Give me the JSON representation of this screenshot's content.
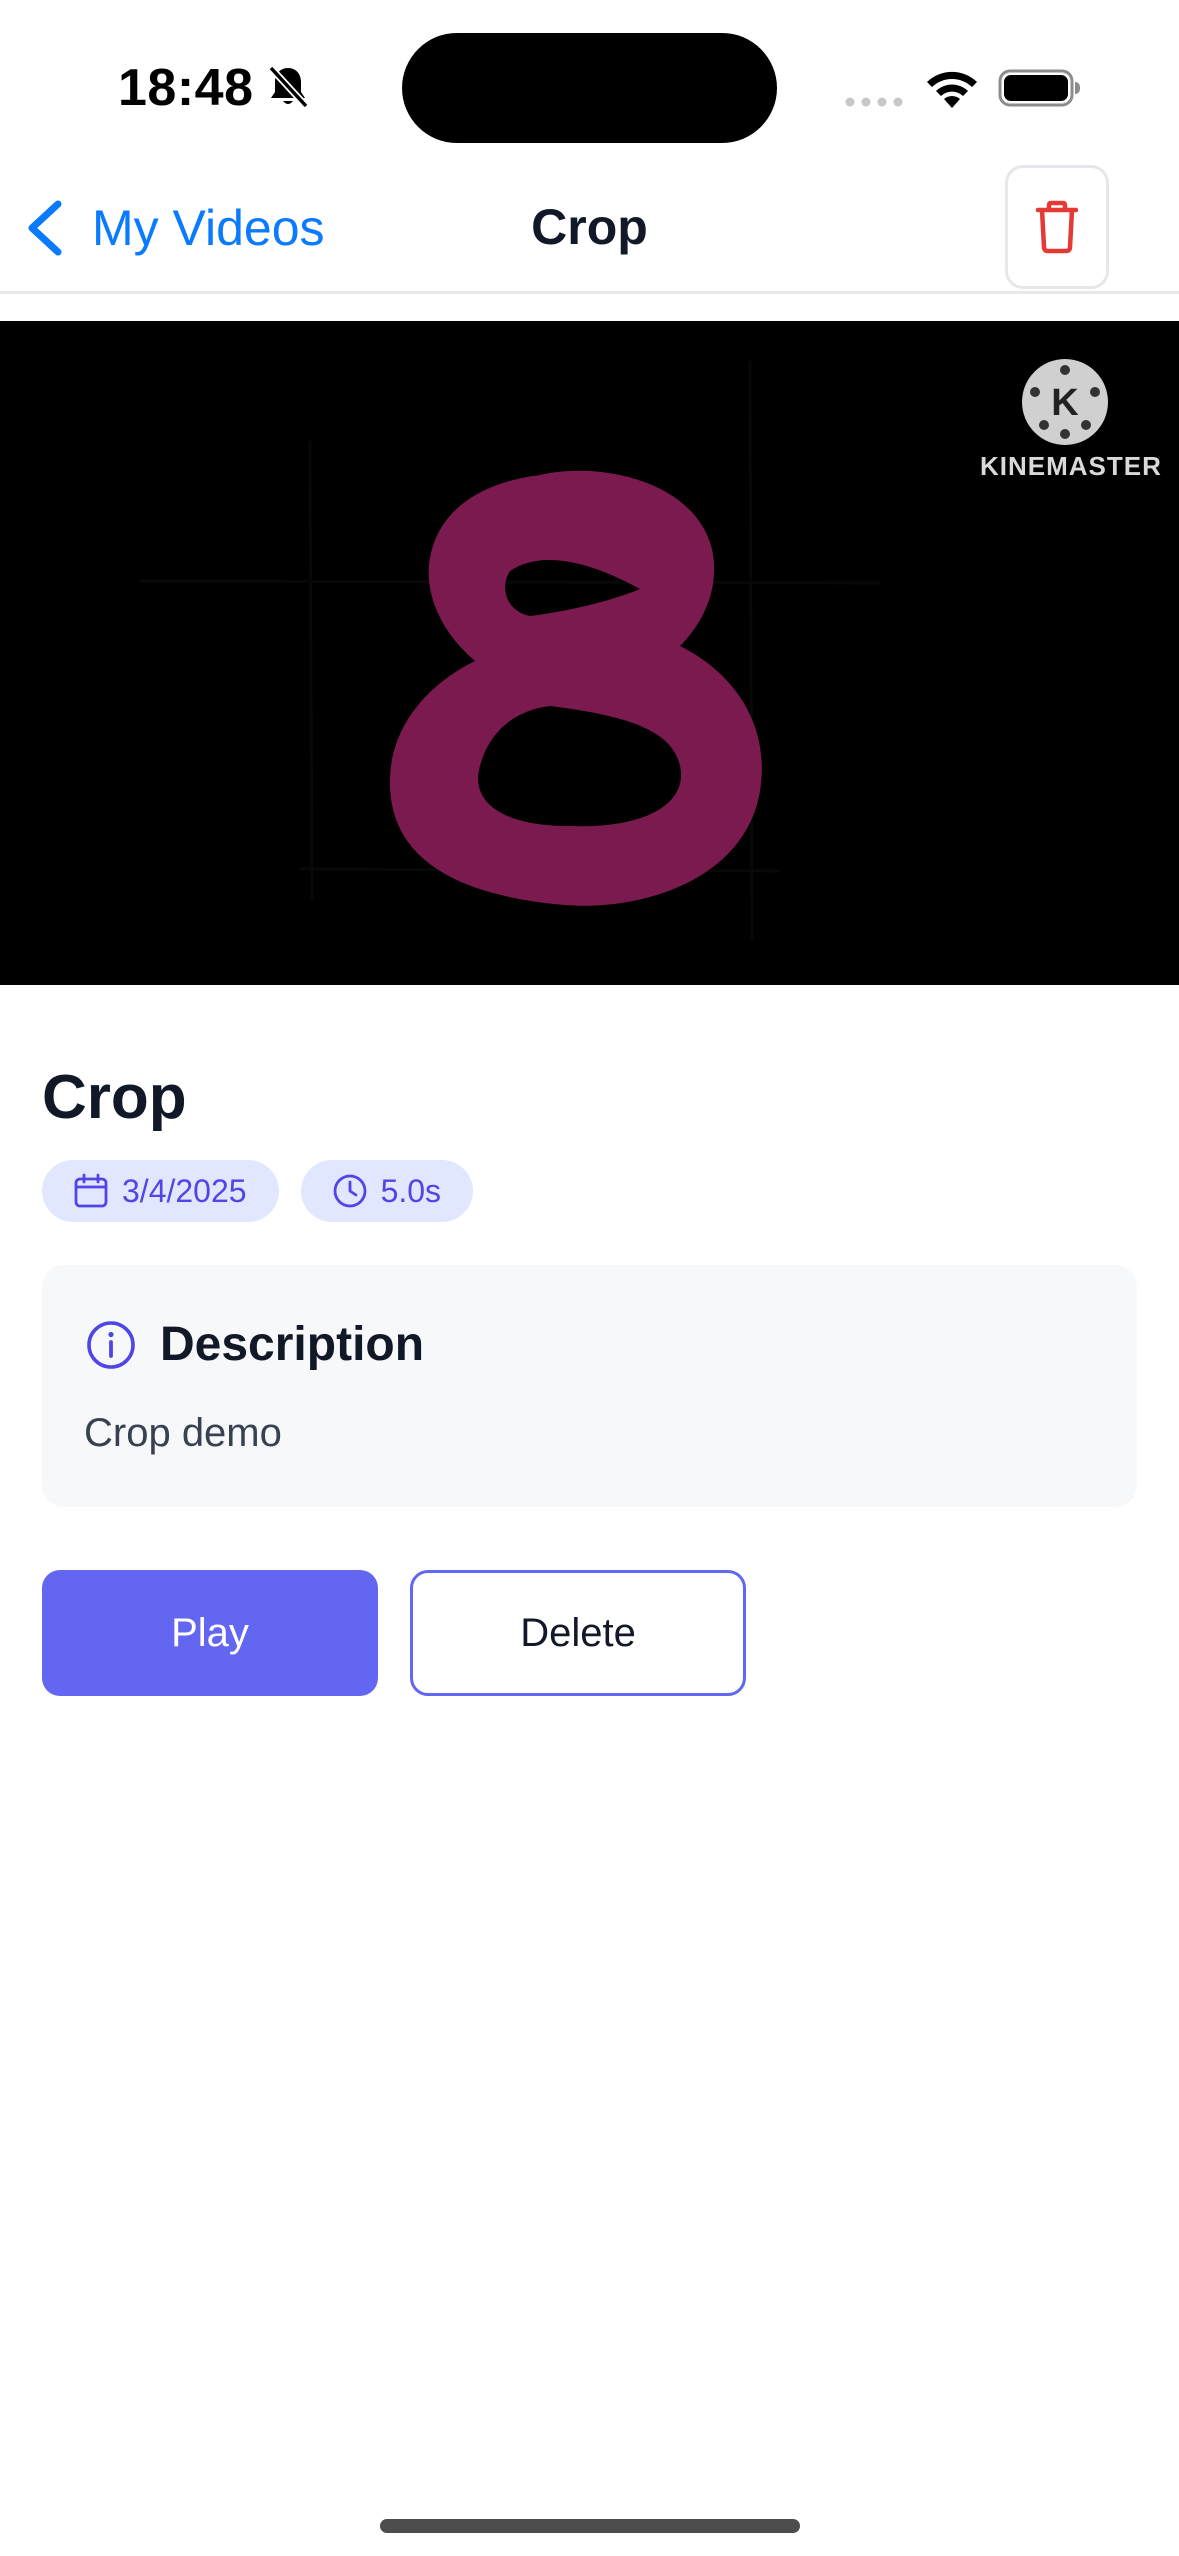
{
  "status_bar": {
    "time": "18:48"
  },
  "nav": {
    "back_label": "My Videos",
    "title": "Crop"
  },
  "video": {
    "watermark": "KINEMASTER",
    "watermark_letter": "K",
    "frame_content": "8"
  },
  "details": {
    "title": "Crop",
    "date": "3/4/2025",
    "duration": "5.0s",
    "description_heading": "Description",
    "description_text": "Crop demo"
  },
  "actions": {
    "play_label": "Play",
    "delete_label": "Delete"
  },
  "colors": {
    "accent": "#6366f1",
    "link": "#0a7aff",
    "danger": "#e53935",
    "badge_bg": "#e0e7ff",
    "figure": "#7a1a4e"
  },
  "icons": {
    "bell_off": "bell-slash-icon",
    "wifi": "wifi-icon",
    "battery": "battery-icon",
    "back": "chevron-left-icon",
    "trash": "trash-icon",
    "calendar": "calendar-icon",
    "clock": "clock-icon",
    "info": "info-circle-icon"
  }
}
